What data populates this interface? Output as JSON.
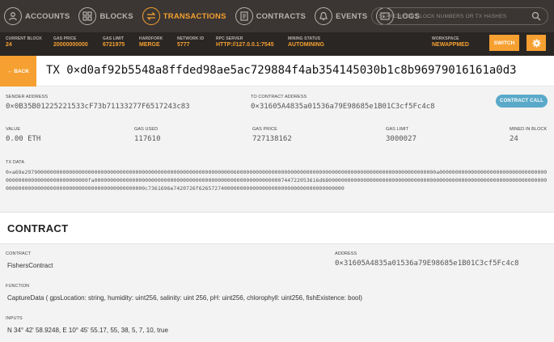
{
  "nav": {
    "items": [
      {
        "label": "ACCOUNTS",
        "icon": "accounts-icon"
      },
      {
        "label": "BLOCKS",
        "icon": "blocks-icon"
      },
      {
        "label": "TRANSACTIONS",
        "icon": "transactions-icon"
      },
      {
        "label": "CONTRACTS",
        "icon": "contracts-icon"
      },
      {
        "label": "EVENTS",
        "icon": "events-icon"
      },
      {
        "label": "LOGS",
        "icon": "logs-icon"
      }
    ],
    "active_index": 2,
    "search_placeholder": "SEARCH FOR BLOCK NUMBERS OR TX HASHES"
  },
  "status": {
    "current_block": {
      "label": "CURRENT BLOCK",
      "value": "24"
    },
    "gas_price": {
      "label": "GAS PRICE",
      "value": "20000000000"
    },
    "gas_limit": {
      "label": "GAS LIMIT",
      "value": "6721975"
    },
    "hardfork": {
      "label": "HARDFORK",
      "value": "MERGE"
    },
    "network_id": {
      "label": "NETWORK ID",
      "value": "5777"
    },
    "rpc_server": {
      "label": "RPC SERVER",
      "value": "HTTP://127.0.0.1:7545"
    },
    "mining_status": {
      "label": "MINING STATUS",
      "value": "AUTOMINING"
    },
    "workspace": {
      "label": "WORKSPACE",
      "value": "NEWAPPMED"
    },
    "switch_label": "SWITCH"
  },
  "tx": {
    "back_label": "← BACK",
    "title": "TX 0×d0af92b5548a8ffded98ae5ac729884f4ab354145030b1c8b96979016161a0d3",
    "sender_label": "SENDER ADDRESS",
    "sender": "0×0B35B01225221533cF73b71133277F6517243c83",
    "to_label": "TO CONTRACT ADDRESS",
    "to": "0×31605A4835a01536a79E98685e1B01C3cf5Fc4c8",
    "contract_call_label": "CONTRACT CALL",
    "value_label": "VALUE",
    "value": "0.00 ETH",
    "gas_used_label": "GAS USED",
    "gas_used": "117610",
    "gas_price_label": "GAS PRICE",
    "gas_price": "727138162",
    "gas_limit_label": "GAS LIMIT",
    "gas_limit": "3000027",
    "mined_label": "MINED IN BLOCK",
    "mined": "24",
    "txdata_label": "TX DATA",
    "txdata": "0×a69e2979000000000000000000000000000000000000000000000000000000000000006000000000000000000000000000000000000000000000000000000000000000a000000000000000000000000000000000000000000000000000000000000fa00000000000000000000000000000000000000000000000000000000000744722053616d6800000000000000000000000000000000000000000000000000000000000000000000000000000000000000000000000000000000000000000c7361696e7420726f6265727400000000000000000000000000000000000000"
  },
  "contract": {
    "section_title": "CONTRACT",
    "contract_label": "CONTRACT",
    "contract_name": "FishersContract",
    "address_label": "ADDRESS",
    "address": "0×31605A4835a01536a79E98685e1B01C3cf5Fc4c8",
    "function_label": "FUNCTION",
    "function": "CaptureData ( gpsLocation: string, humidity: uint256, salinity: uint 256, pH: uint256, chlorophyll: uint256, fishExistence: bool)",
    "inputs_label": "INPUTS",
    "inputs": "N  34°  42'  58.9248,  E 10° 45'  55.17, 55,  38,  5,  7,  10,  true"
  },
  "colors": {
    "accent": "#f5a030",
    "nav_bg": "#3b3633",
    "status_bg": "#2a2624",
    "contract_call": "#5aa9c9"
  }
}
